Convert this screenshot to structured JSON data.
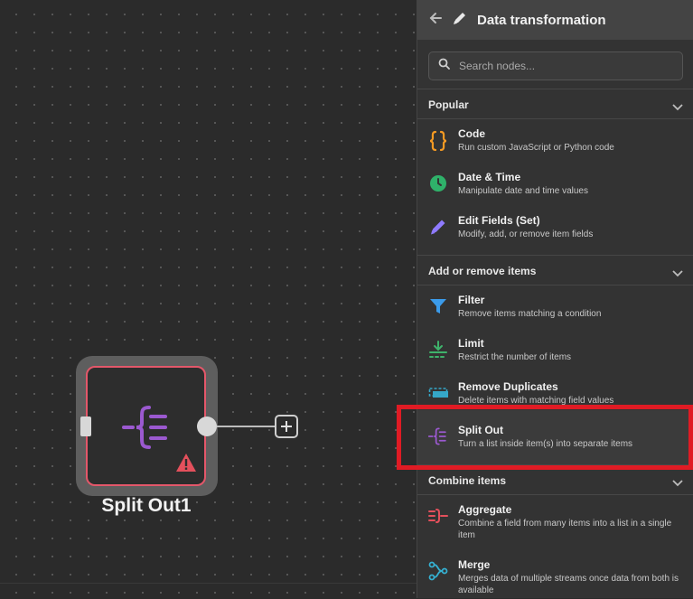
{
  "canvas": {
    "node": {
      "label": "Split Out1"
    }
  },
  "panel": {
    "title": "Data transformation",
    "search": {
      "placeholder": "Search nodes..."
    },
    "sections": [
      {
        "title": "Popular",
        "items": [
          {
            "title": "Code",
            "desc": "Run custom JavaScript or Python code",
            "icon": "code-braces-icon",
            "color": "#f59a23"
          },
          {
            "title": "Date & Time",
            "desc": "Manipulate date and time values",
            "icon": "clock-icon",
            "color": "#2fb26a"
          },
          {
            "title": "Edit Fields (Set)",
            "desc": "Modify, add, or remove item fields",
            "icon": "pencil-icon",
            "color": "#8f7bff"
          }
        ]
      },
      {
        "title": "Add or remove items",
        "items": [
          {
            "title": "Filter",
            "desc": "Remove items matching a condition",
            "icon": "filter-icon",
            "color": "#3b9bea"
          },
          {
            "title": "Limit",
            "desc": "Restrict the number of items",
            "icon": "limit-icon",
            "color": "#3fb36b"
          },
          {
            "title": "Remove Duplicates",
            "desc": "Delete items with matching field values",
            "icon": "remove-duplicates-icon",
            "color": "#35a7c8"
          },
          {
            "title": "Split Out",
            "desc": "Turn a list inside item(s) into separate items",
            "icon": "split-out-icon",
            "color": "#9b59d0"
          }
        ]
      },
      {
        "title": "Combine items",
        "items": [
          {
            "title": "Aggregate",
            "desc": "Combine a field from many items into a list in a single item",
            "icon": "aggregate-icon",
            "color": "#e4505c"
          },
          {
            "title": "Merge",
            "desc": "Merges data of multiple streams once data from both is available",
            "icon": "merge-icon",
            "color": "#35b1d2"
          }
        ]
      }
    ]
  }
}
